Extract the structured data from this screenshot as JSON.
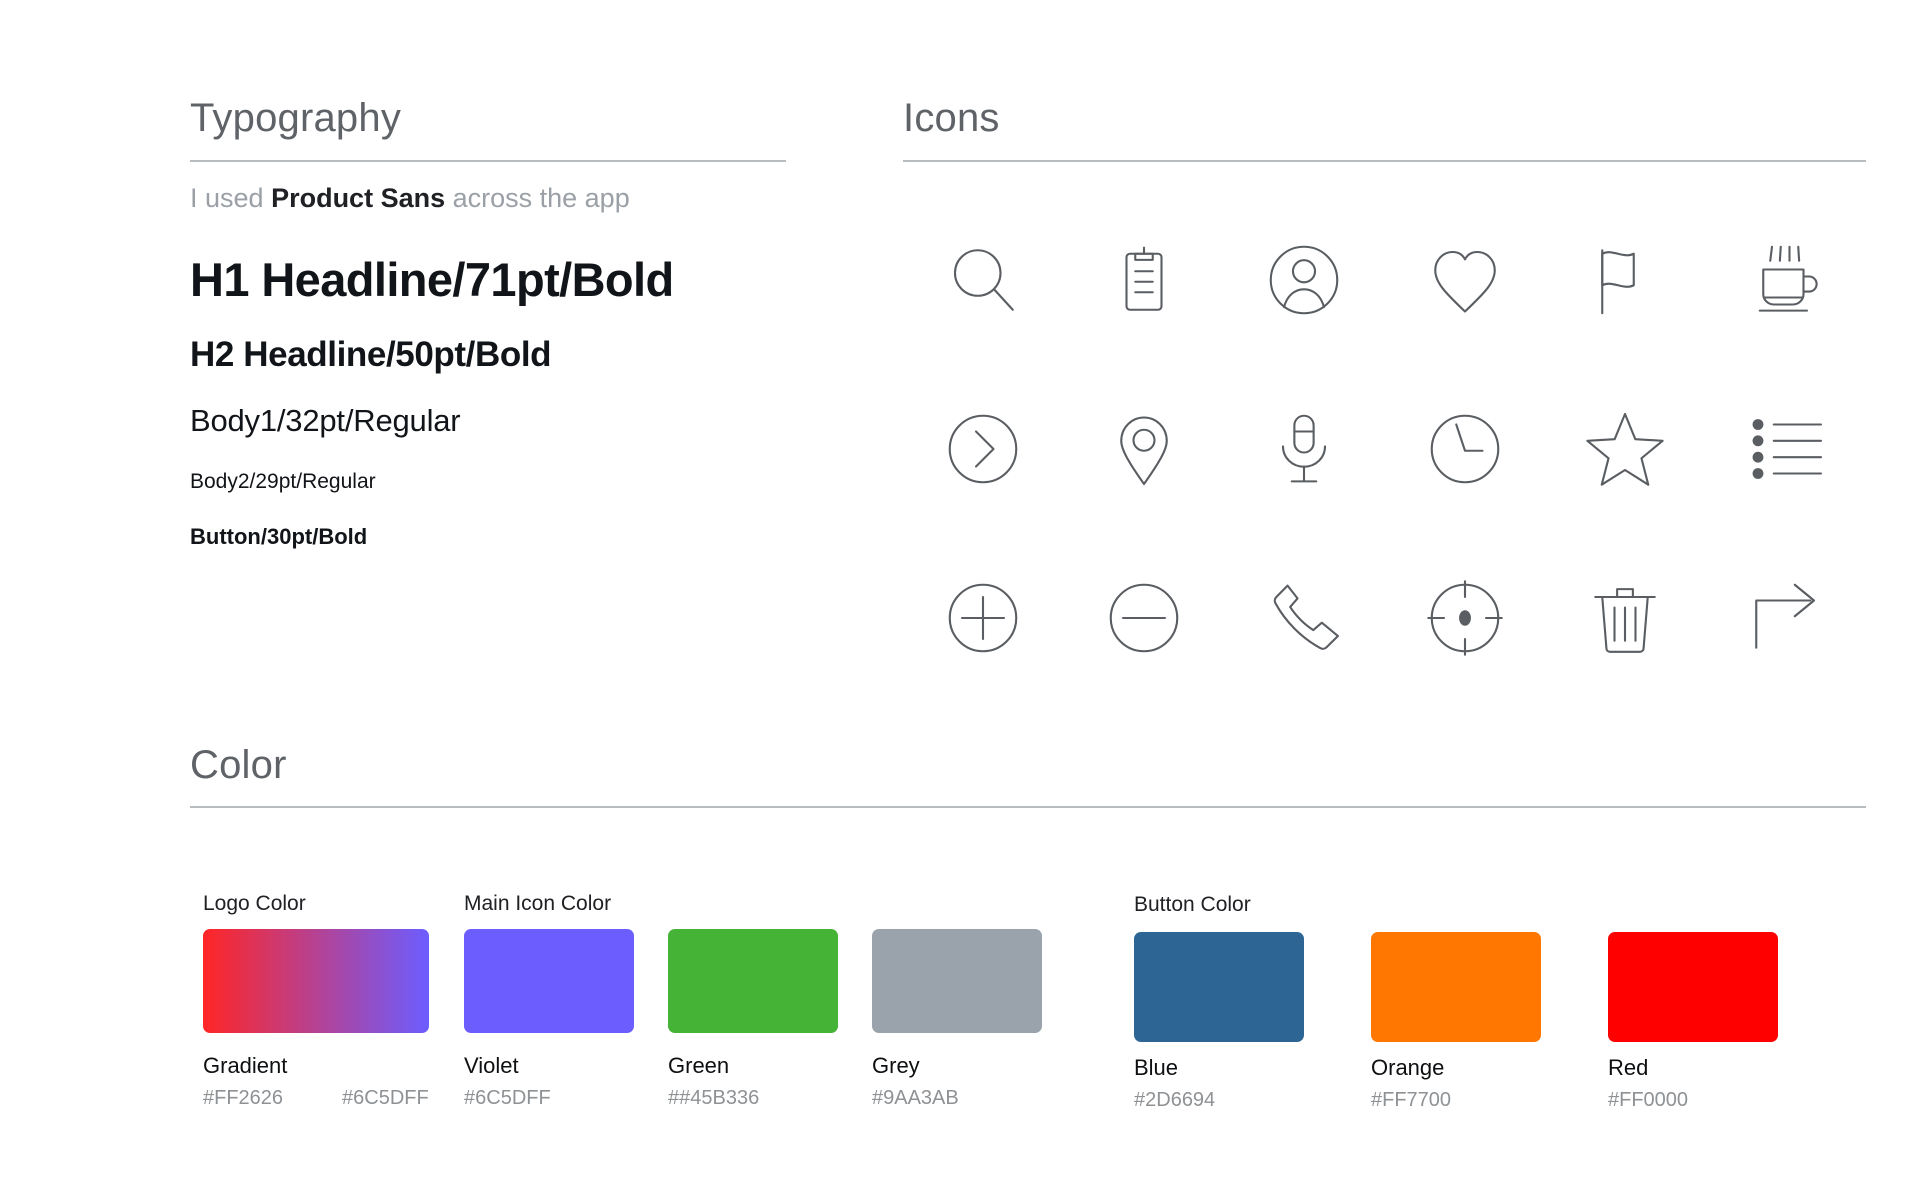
{
  "typography": {
    "section_title": "Typography",
    "intro": {
      "before": "I used ",
      "highlight": "Product Sans",
      "after": " across the app"
    },
    "samples": [
      {
        "label": "H1 Headline/71pt/Bold"
      },
      {
        "label": "H2 Headline/50pt/Bold"
      },
      {
        "label": "Body1/32pt/Regular"
      },
      {
        "label": "Body2/29pt/Regular"
      },
      {
        "label": "Button/30pt/Bold"
      }
    ]
  },
  "icons": {
    "section_title": "Icons",
    "items": [
      {
        "name": "search-icon"
      },
      {
        "name": "clipboard-icon"
      },
      {
        "name": "user-circle-icon"
      },
      {
        "name": "heart-icon"
      },
      {
        "name": "flag-icon"
      },
      {
        "name": "coffee-cup-icon"
      },
      {
        "name": "chevron-right-circle-icon"
      },
      {
        "name": "location-pin-icon"
      },
      {
        "name": "microphone-icon"
      },
      {
        "name": "clock-icon"
      },
      {
        "name": "star-icon"
      },
      {
        "name": "list-icon"
      },
      {
        "name": "plus-circle-icon"
      },
      {
        "name": "minus-circle-icon"
      },
      {
        "name": "phone-icon"
      },
      {
        "name": "target-icon"
      },
      {
        "name": "trash-icon"
      },
      {
        "name": "share-arrow-icon"
      }
    ]
  },
  "color": {
    "section_title": "Color",
    "group_labels": {
      "logo": "Logo Color",
      "main_icon": "Main Icon Color",
      "button": "Button Color"
    },
    "swatches": [
      {
        "name": "Gradient",
        "hex": "#FF2626",
        "hex2": "#6C5DFF",
        "fill": "linear-gradient(to right, #FF2626 0%, #6C5DFF 100%)"
      },
      {
        "name": "Violet",
        "hex": "#6C5DFF",
        "fill": "#6C5DFF"
      },
      {
        "name": "Green",
        "hex": "##45B336",
        "fill": "#45B336"
      },
      {
        "name": "Grey",
        "hex": "#9AA3AB",
        "fill": "#9AA3AB"
      },
      {
        "name": "Blue",
        "hex": "#2D6694",
        "fill": "#2D6694"
      },
      {
        "name": "Orange",
        "hex": "#FF7700",
        "fill": "#FF7700"
      },
      {
        "name": "Red",
        "hex": "#FF0000",
        "fill": "#FF0000"
      }
    ]
  }
}
